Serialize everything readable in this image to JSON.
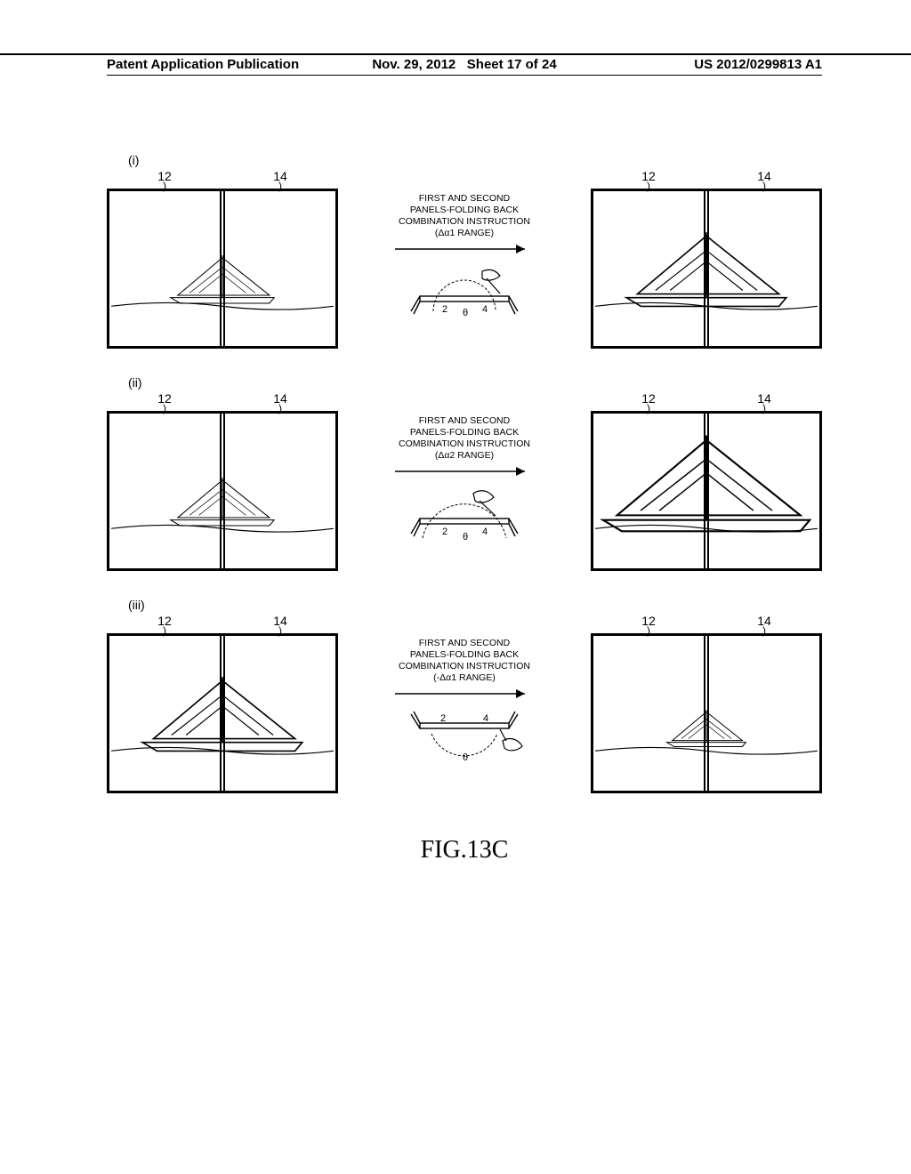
{
  "header": {
    "left": "Patent Application Publication",
    "date": "Nov. 29, 2012",
    "sheet": "Sheet 17 of 24",
    "pubno": "US 2012/0299813 A1"
  },
  "labels": {
    "panel_left": "12",
    "panel_right": "14",
    "hinge_left": "2",
    "hinge_right": "4",
    "theta": "θ"
  },
  "rows": [
    {
      "roman": "(i)",
      "instruction_l1": "FIRST AND SECOND",
      "instruction_l2": "PANELS-FOLDING BACK",
      "instruction_l3": "COMBINATION INSTRUCTION",
      "range": "(Δα1 RANGE)",
      "boat_scale_left": 0.55,
      "boat_scale_right": 0.85,
      "arc_deg": 90,
      "arc_below": false
    },
    {
      "roman": "(ii)",
      "instruction_l1": "FIRST AND SECOND",
      "instruction_l2": "PANELS-FOLDING BACK",
      "instruction_l3": "COMBINATION INSTRUCTION",
      "range": "(Δα2 RANGE)",
      "boat_scale_left": 0.55,
      "boat_scale_right": 1.1,
      "arc_deg": 150,
      "arc_below": false
    },
    {
      "roman": "(iii)",
      "instruction_l1": "FIRST AND SECOND",
      "instruction_l2": "PANELS-FOLDING BACK",
      "instruction_l3": "COMBINATION INSTRUCTION",
      "range": "(-Δα1 RANGE)",
      "boat_scale_left": 0.85,
      "boat_scale_right": 0.42,
      "arc_deg": 90,
      "arc_below": true
    }
  ],
  "figure_caption": "FIG.13C"
}
